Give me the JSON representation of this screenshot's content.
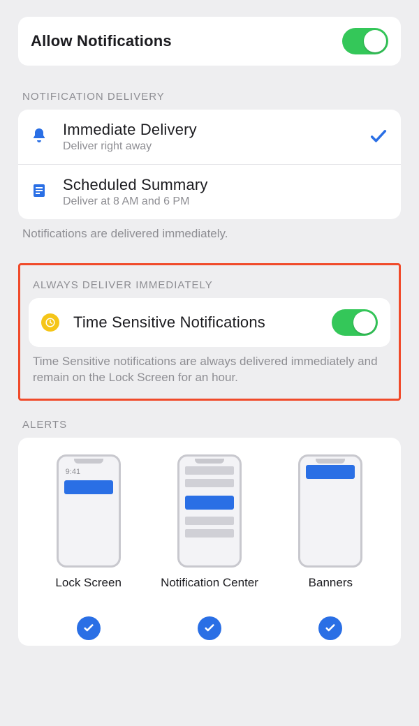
{
  "allow": {
    "label": "Allow Notifications",
    "on": true
  },
  "delivery": {
    "header": "NOTIFICATION DELIVERY",
    "items": [
      {
        "id": "immediate",
        "title": "Immediate Delivery",
        "sub": "Deliver right away",
        "selected": true
      },
      {
        "id": "scheduled",
        "title": "Scheduled Summary",
        "sub": "Deliver at 8 AM and 6 PM",
        "selected": false
      }
    ],
    "footer": "Notifications are delivered immediately."
  },
  "timeSensitive": {
    "header": "ALWAYS DELIVER IMMEDIATELY",
    "label": "Time Sensitive Notifications",
    "on": true,
    "footer": "Time Sensitive notifications are always delivered immediately and remain on the Lock Screen for an hour."
  },
  "alerts": {
    "header": "ALERTS",
    "lockScreen": {
      "label": "Lock Screen",
      "time": "9:41",
      "checked": true
    },
    "notificationCenter": {
      "label": "Notification Center",
      "checked": true
    },
    "banners": {
      "label": "Banners",
      "checked": true
    }
  }
}
